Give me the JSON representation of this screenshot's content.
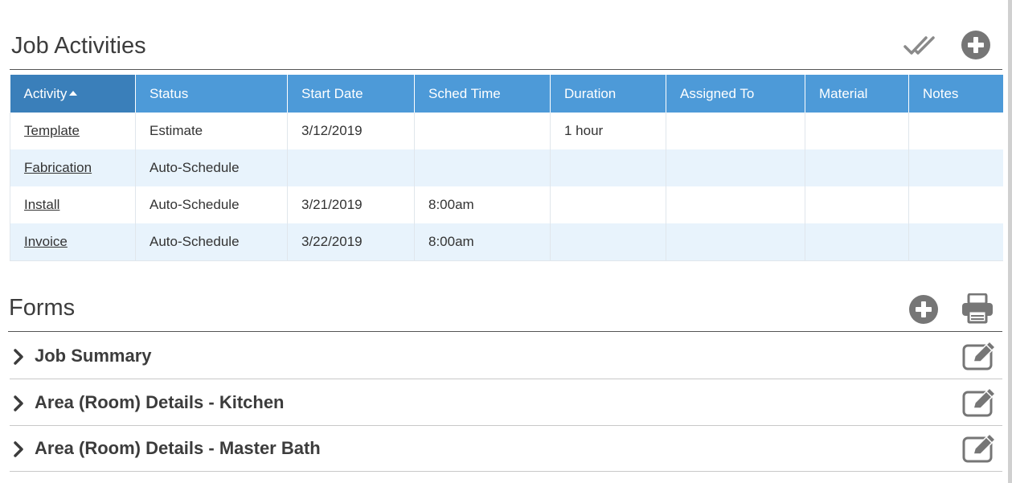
{
  "job_activities": {
    "title": "Job Activities",
    "actions": {
      "complete_icon": "double-check-icon",
      "add_icon": "plus-circle-icon"
    },
    "table": {
      "columns": [
        "Activity",
        "Status",
        "Start Date",
        "Sched Time",
        "Duration",
        "Assigned To",
        "Material",
        "Notes"
      ],
      "sorted_column": "Activity",
      "sort_direction": "ascending",
      "rows": [
        {
          "activity": "Template",
          "status": "Estimate",
          "start_date": "3/12/2019",
          "sched_time": "",
          "duration": "1 hour",
          "assigned_to": "",
          "material": "",
          "notes": ""
        },
        {
          "activity": "Fabrication",
          "status": "Auto-Schedule",
          "start_date": "",
          "sched_time": "",
          "duration": "",
          "assigned_to": "",
          "material": "",
          "notes": ""
        },
        {
          "activity": "Install",
          "status": "Auto-Schedule",
          "start_date": "3/21/2019",
          "sched_time": "8:00am",
          "duration": "",
          "assigned_to": "",
          "material": "",
          "notes": ""
        },
        {
          "activity": "Invoice",
          "status": "Auto-Schedule",
          "start_date": "3/22/2019",
          "sched_time": "8:00am",
          "duration": "",
          "assigned_to": "",
          "material": "",
          "notes": ""
        }
      ]
    }
  },
  "forms": {
    "title": "Forms",
    "actions": {
      "add_icon": "plus-circle-icon",
      "print_icon": "printer-icon"
    },
    "items": [
      {
        "title": "Job Summary",
        "icon": "edit-icon"
      },
      {
        "title": "Area (Room) Details - Kitchen",
        "icon": "edit-icon"
      },
      {
        "title": "Area (Room) Details - Master Bath",
        "icon": "edit-icon"
      }
    ]
  },
  "colors": {
    "header_blue": "#4d9ad8",
    "header_sorted_blue": "#3a7fba",
    "row_stripe": "#e8f3fc",
    "status_auto": "#8b1a8b",
    "icon_gray": "#767676"
  }
}
